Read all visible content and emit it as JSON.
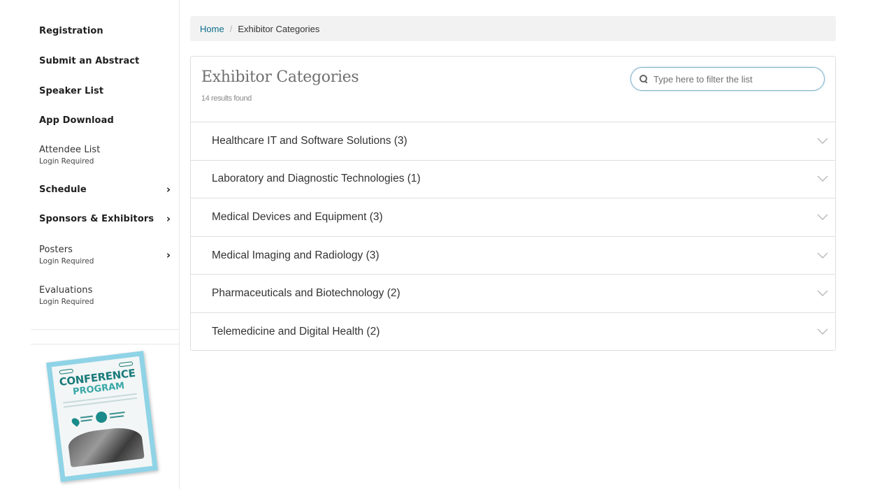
{
  "sidebar": {
    "items": [
      {
        "label": "Registration",
        "sub": "",
        "chevron": false
      },
      {
        "label": "Submit an Abstract",
        "sub": "",
        "chevron": false
      },
      {
        "label": "Speaker List",
        "sub": "",
        "chevron": false
      },
      {
        "label": "App Download",
        "sub": "",
        "chevron": false
      },
      {
        "label": "Attendee List",
        "sub": "Login Required",
        "chevron": false
      },
      {
        "label": "Schedule",
        "sub": "",
        "chevron": true
      },
      {
        "label": "Sponsors & Exhibitors",
        "sub": "",
        "chevron": true
      },
      {
        "label": "Posters",
        "sub": "Login Required",
        "chevron": true
      },
      {
        "label": "Evaluations",
        "sub": "Login Required",
        "chevron": false
      }
    ],
    "chevron_glyph": "›",
    "program_image": {
      "title_line1": "CONFERENCE",
      "title_line2": "PROGRAM"
    }
  },
  "breadcrumb": {
    "home": "Home",
    "separator": "/",
    "current": "Exhibitor Categories"
  },
  "panel": {
    "title": "Exhibitor Categories",
    "count": "14 results found",
    "search_placeholder": "Type here to filter the list",
    "categories": [
      "Healthcare IT and Software Solutions (3)",
      "Laboratory and Diagnostic Technologies (1)",
      "Medical Devices and Equipment (3)",
      "Medical Imaging and Radiology (3)",
      "Pharmaceuticals and Biotechnology (2)",
      "Telemedicine and Digital Health (2)"
    ]
  },
  "colors": {
    "link": "#0d6e8c",
    "search_border": "#7fb1c9",
    "booklet_accent": "#1a7a7a",
    "booklet_frame": "#8fd3e6"
  },
  "icons": {
    "search": "search-icon",
    "chevron_row": "chevron-down-icon",
    "chevron_nav": "chevron-right-icon"
  }
}
